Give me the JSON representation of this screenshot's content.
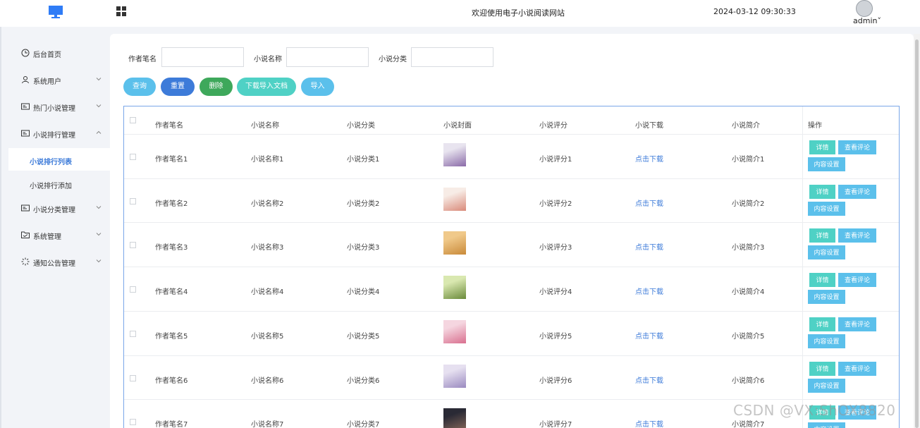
{
  "header": {
    "title": "欢迎使用电子小说阅读网站",
    "datetime": "2024-03-12 09:30:33",
    "user": "admin",
    "user_caret": "˅"
  },
  "sidebar": {
    "items": [
      {
        "label": "后台首页",
        "icon": "clock-icon"
      },
      {
        "label": "系统用户",
        "icon": "user-icon"
      },
      {
        "label": "热门小说管理",
        "icon": "card-icon"
      },
      {
        "label": "小说排行管理",
        "icon": "card-icon"
      },
      {
        "label": "小说分类管理",
        "icon": "card-icon"
      },
      {
        "label": "系统管理",
        "icon": "folder-icon"
      },
      {
        "label": "通知公告管理",
        "icon": "spark-icon"
      }
    ],
    "subitems": [
      {
        "label": "小说排行列表",
        "active": true
      },
      {
        "label": "小说排行添加",
        "active": false
      }
    ]
  },
  "filters": {
    "author_label": "作者笔名",
    "author_value": "",
    "name_label": "小说名称",
    "name_value": "",
    "category_label": "小说分类",
    "category_value": ""
  },
  "buttons": {
    "query": "查询",
    "reset": "重置",
    "delete": "删除",
    "download_template": "下载导入文档",
    "import": "导入"
  },
  "table": {
    "headers": [
      "作者笔名",
      "小说名称",
      "小说分类",
      "小说封面",
      "小说评分",
      "小说下载",
      "小说简介",
      "操作"
    ],
    "rows": [
      {
        "author": "作者笔名1",
        "name": "小说名称1",
        "category": "小说分类1",
        "rating": "小说评分1",
        "download": "点击下载",
        "intro": "小说简介1"
      },
      {
        "author": "作者笔名2",
        "name": "小说名称2",
        "category": "小说分类2",
        "rating": "小说评分2",
        "download": "点击下载",
        "intro": "小说简介2"
      },
      {
        "author": "作者笔名3",
        "name": "小说名称3",
        "category": "小说分类3",
        "rating": "小说评分3",
        "download": "点击下载",
        "intro": "小说简介3"
      },
      {
        "author": "作者笔名4",
        "name": "小说名称4",
        "category": "小说分类4",
        "rating": "小说评分4",
        "download": "点击下载",
        "intro": "小说简介4"
      },
      {
        "author": "作者笔名5",
        "name": "小说名称5",
        "category": "小说分类5",
        "rating": "小说评分5",
        "download": "点击下载",
        "intro": "小说简介5"
      },
      {
        "author": "作者笔名6",
        "name": "小说名称6",
        "category": "小说分类6",
        "rating": "小说评分6",
        "download": "点击下载",
        "intro": "小说简介6"
      },
      {
        "author": "作者笔名7",
        "name": "小说名称7",
        "category": "小说分类7",
        "rating": "小说评分7",
        "download": "点击下载",
        "intro": "小说简介7"
      }
    ],
    "actions": {
      "detail": "详情",
      "review": "查看评论",
      "content": "内容设置"
    }
  },
  "watermark": "CSDN @VX:ShOX8820",
  "colors": {
    "primary": "#3d7bd9",
    "query_btn": "#5bc0eb",
    "reset_btn": "#3d7bd9",
    "delete_btn": "#3ea85b",
    "teal_btn": "#4fd1c5",
    "link": "#3d7bd9"
  }
}
